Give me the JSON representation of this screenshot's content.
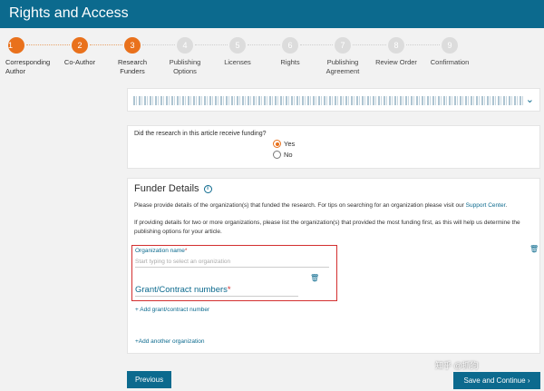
{
  "header": {
    "title": "Rights and Access"
  },
  "stepper": {
    "steps": [
      {
        "num": "1",
        "label": "Corresponding\nAuthor",
        "state": "active"
      },
      {
        "num": "2",
        "label": "Co-Author",
        "state": "active"
      },
      {
        "num": "3",
        "label": "Research\nFunders",
        "state": "active"
      },
      {
        "num": "4",
        "label": "Publishing\nOptions",
        "state": "inactive"
      },
      {
        "num": "5",
        "label": "Licenses",
        "state": "inactive"
      },
      {
        "num": "6",
        "label": "Rights",
        "state": "inactive"
      },
      {
        "num": "7",
        "label": "Publishing\nAgreement",
        "state": "inactive"
      },
      {
        "num": "8",
        "label": "Review Order",
        "state": "inactive"
      },
      {
        "num": "9",
        "label": "Confirmation",
        "state": "inactive"
      }
    ]
  },
  "funding": {
    "question": "Did the research in this article receive funding?",
    "yes_label": "Yes",
    "no_label": "No",
    "selected": "yes"
  },
  "funder": {
    "title": "Funder Details",
    "info_text_before_link": "Please provide details of the organization(s) that funded the research. For tips on searching for an organization please visit our ",
    "support_link": "Support Center",
    "info_text_after_link": ".",
    "multi_org_text": "If providing details for two or more organizations, please list the organization(s) that provided the most funding first, as this will help us determine the publishing options for your article.",
    "org_label": "Organization name",
    "org_placeholder": "Start typing to select an organization",
    "required_mark": "*",
    "grant_label": "Grant/Contract numbers",
    "add_grant": "+ Add grant/contract number",
    "add_org": "+Add another organization"
  },
  "buttons": {
    "previous": "Previous",
    "save_continue": "Save and Continue"
  },
  "watermark": "知乎 @抓狗",
  "colors": {
    "primary": "#0c6a8e",
    "accent": "#e9711c",
    "required": "#d32f2f"
  }
}
